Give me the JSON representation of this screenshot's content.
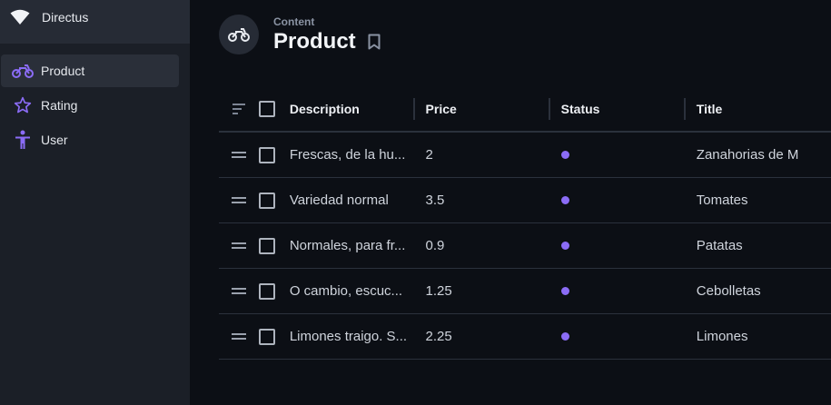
{
  "brand": {
    "name": "Directus"
  },
  "sidebar": {
    "items": [
      {
        "label": "Product",
        "icon": "motorcycle-icon",
        "active": true
      },
      {
        "label": "Rating",
        "icon": "star-icon",
        "active": false
      },
      {
        "label": "User",
        "icon": "accessibility-icon",
        "active": false
      }
    ]
  },
  "header": {
    "breadcrumb": "Content",
    "title": "Product"
  },
  "table": {
    "columns": [
      "Description",
      "Price",
      "Status",
      "Title"
    ],
    "rows": [
      {
        "description": "Frescas, de la hu...",
        "price": "2",
        "title": "Zanahorias de M"
      },
      {
        "description": "Variedad normal",
        "price": "3.5",
        "title": "Tomates"
      },
      {
        "description": "Normales, para fr...",
        "price": "0.9",
        "title": "Patatas"
      },
      {
        "description": "O cambio, escuc...",
        "price": "1.25",
        "title": "Cebolletas"
      },
      {
        "description": "Limones traigo. S...",
        "price": "2.25",
        "title": "Limones"
      }
    ]
  },
  "colors": {
    "accent": "#8b6cf6",
    "sidebar": "#1b1f27",
    "background": "#0c0f15"
  }
}
